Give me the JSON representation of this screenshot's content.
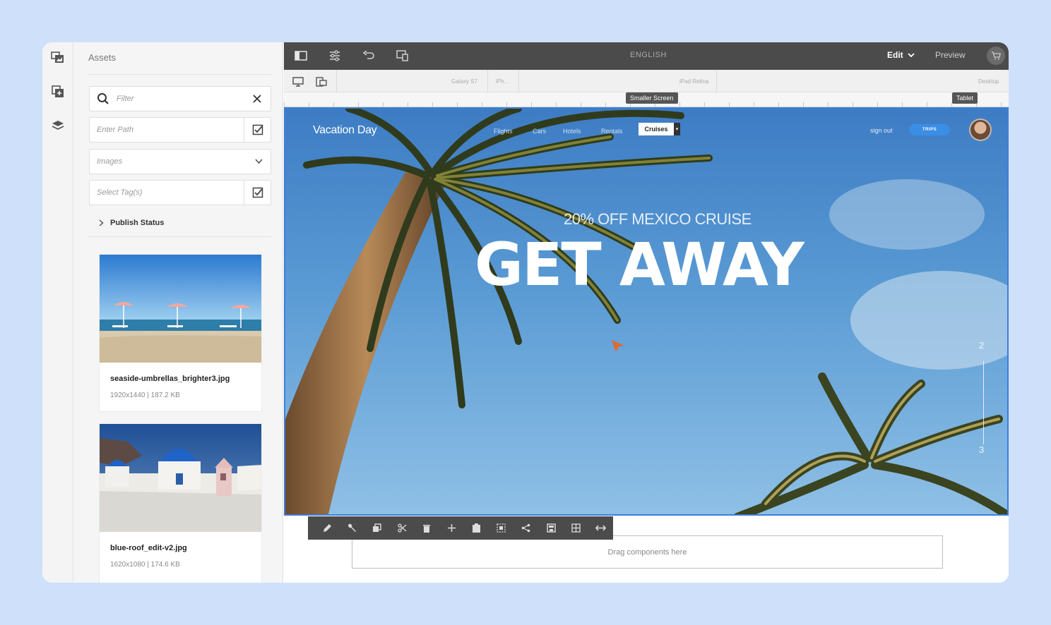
{
  "assets_panel": {
    "title": "Assets",
    "filter_placeholder": "Filter",
    "path_placeholder": "Enter Path",
    "type_select": "Images",
    "tags_placeholder": "Select Tag(s)",
    "publish_status": "Publish Status",
    "items": [
      {
        "name": "seaside-umbrellas_brighter3.jpg",
        "meta": "1920x1440 | 187.2 KB"
      },
      {
        "name": "blue-roof_edit-v2.jpg",
        "meta": "1620x1080 | 174.6 KB"
      }
    ]
  },
  "topbar": {
    "language": "ENGLISH",
    "mode": "Edit",
    "preview": "Preview"
  },
  "devicebar": {
    "labels": [
      "Galaxy S7",
      "iPh...",
      "iPad Retina",
      "Desktop"
    ],
    "tooltip_smaller": "Smaller Screen",
    "tooltip_tablet": "Tablet"
  },
  "site": {
    "logo": "Vacation Day",
    "nav": [
      "Flights",
      "Cars",
      "Hotels",
      "Rentals"
    ],
    "active_nav": "Cruises",
    "sign_out": "sign out",
    "trips": "TRIPS",
    "promo": "20% OFF MEXICO CRUISE",
    "headline": "GET AWAY",
    "slide_numbers": [
      "2",
      "3"
    ]
  },
  "dropzone": "Drag components here",
  "colors": {
    "selection_border": "#3f7ed8",
    "toolbar_bg": "#4b4b4b",
    "page_bg": "#cfe0fb"
  }
}
